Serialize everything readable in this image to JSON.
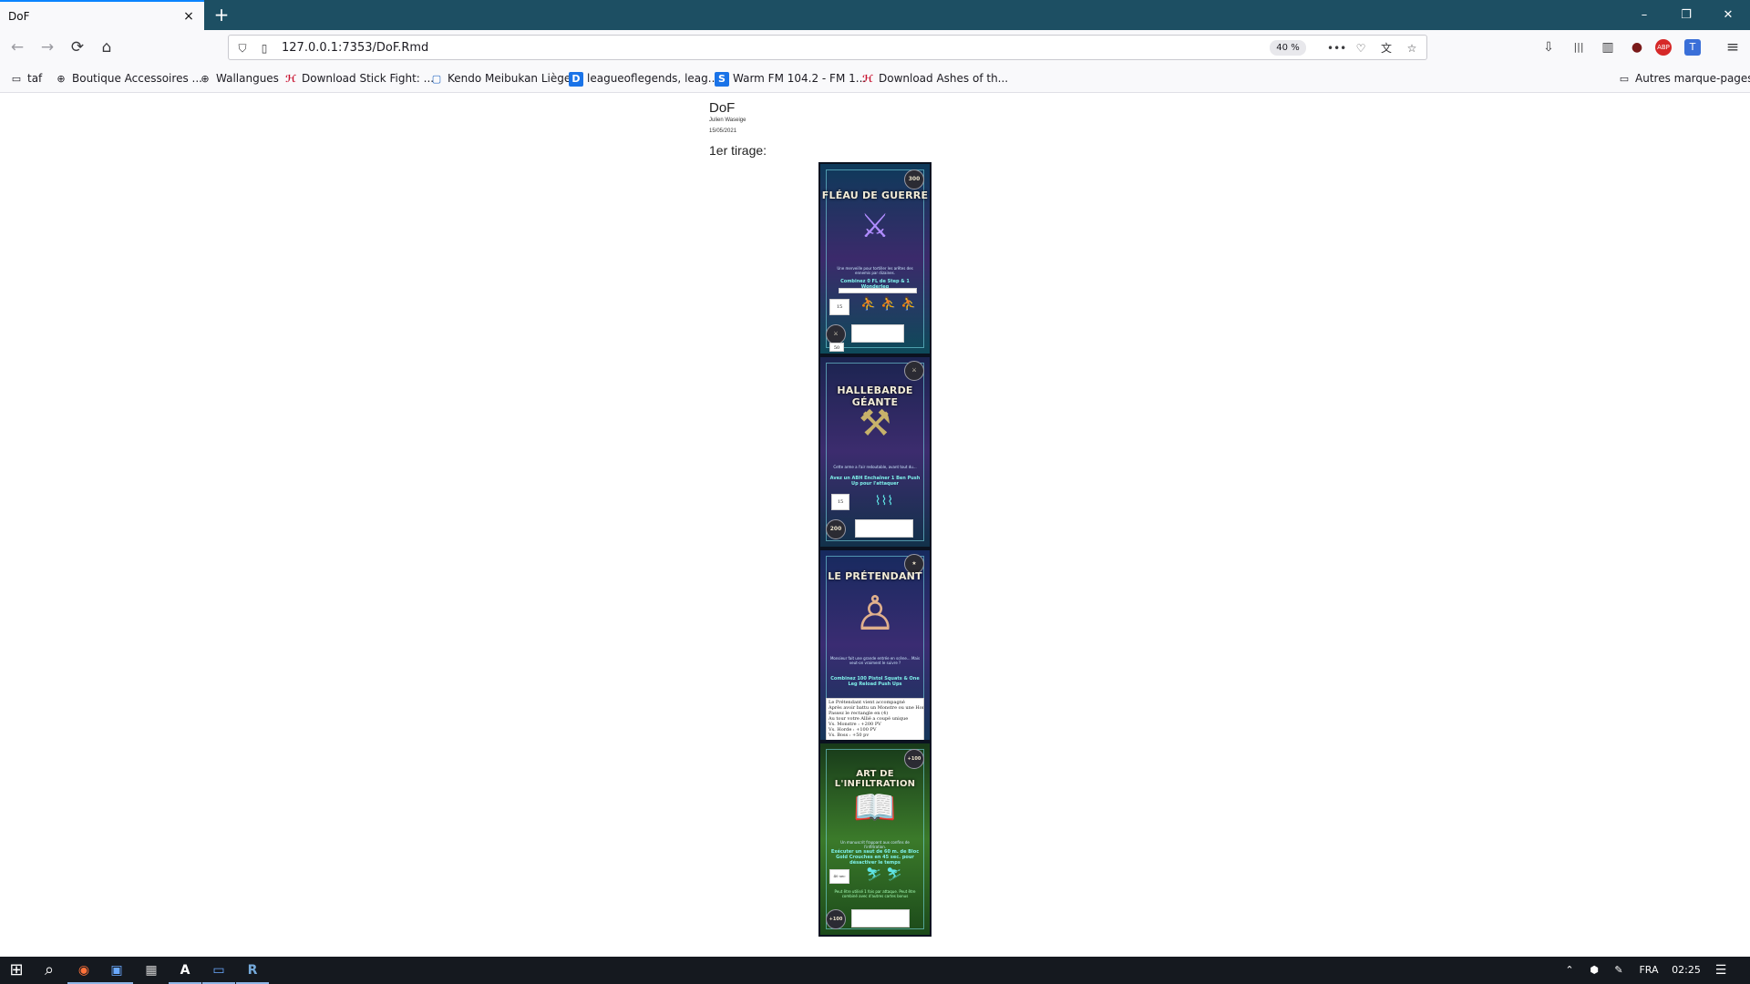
{
  "browser": {
    "tab": {
      "title": "DoF",
      "close_icon": "×"
    },
    "new_tab": "+",
    "window_controls": {
      "minimize": "–",
      "restore": "❐",
      "close": "✕"
    },
    "nav": {
      "back": "←",
      "forward": "→",
      "reload": "⟳",
      "home": "⌂"
    },
    "url": "127.0.0.1:7353/DoF.Rmd",
    "zoom": "40 %",
    "page_actions": {
      "more": "•••",
      "pocket": "♡",
      "translate": "文",
      "bookmark_star": "☆"
    },
    "toolbar_icons": {
      "downloads": "⇩",
      "library": "|||",
      "sidebar": "▥",
      "account": "●",
      "adblock": "ABP",
      "translator": "T",
      "menu": "≡"
    },
    "bookmarks": [
      {
        "label": "taf",
        "icon": "folder-icon",
        "glyph": "▭",
        "color": "#555555"
      },
      {
        "label": "Boutique Accessoires ...",
        "icon": "globe-icon",
        "glyph": "⊕",
        "color": "#555555"
      },
      {
        "label": "Wallangues",
        "icon": "globe-icon",
        "glyph": "⊕",
        "color": "#555555"
      },
      {
        "label": "Download Stick Fight: ...",
        "icon": "download-site-icon",
        "glyph": "ℋ",
        "color": "#c8102e"
      },
      {
        "label": "Kendo Meibukan Liège",
        "icon": "page-icon",
        "glyph": "▢",
        "color": "#2b6cc4"
      },
      {
        "label": "leagueoflegends, leag...",
        "icon": "site-icon",
        "glyph": "D",
        "color": "#1a73e8"
      },
      {
        "label": "Warm FM 104.2 - FM 1...",
        "icon": "radio-icon",
        "glyph": "S",
        "color": "#1a73e8"
      },
      {
        "label": "Download Ashes of th...",
        "icon": "download-site-icon",
        "glyph": "ℋ",
        "color": "#c8102e"
      }
    ],
    "other_bookmarks": "Autres marque-pages"
  },
  "document": {
    "title": "DoF",
    "author": "Julien Waseige",
    "date": "15/05/2021",
    "section": "1er tirage:"
  },
  "cards": [
    {
      "title": "FLÉAU DE GUERRE",
      "text": "Une merveille pour tortiller les arêtes des ennemis par dizaines.",
      "objective": "Combinez 0 FL de Step & 1 Wonderleg",
      "badge": "300",
      "value_box": "15",
      "stat_box": "50",
      "bg_top": "#0e3a5a",
      "bg_mid": "#3b2a6b",
      "bg_bottom": "#0e4a5a"
    },
    {
      "title": "HALLEBARDE GÉANTE",
      "text": "Cette arme a l'air redoutable, avant tout du...",
      "objective": "Avez un ABH Enchaîner 1 Ben Push Up pour l'attaquer",
      "badge": "200",
      "value_box": "15",
      "bg_top": "#1b2450",
      "bg_mid": "#3c2c6e",
      "bg_bottom": "#12314a"
    },
    {
      "title": "LE PRÉTENDANT",
      "text": "Monsieur fait une grande entrée en scène... Mais veut-on vraiment le suivre ?",
      "objective": "Combinez 100 Pistol Squats & One Leg Reload Push Ups",
      "notes": [
        "Le Prétendant vient accompagné",
        "Après avoir battu un Monstre ou une Horde",
        "Passez le rectangle en (4)",
        "Au tour votre Allié a coupé unique",
        "Vs. Monstre : +200 PV",
        "Vs. Horde : +100 PV",
        "Vs. Boss : +50 pv"
      ],
      "bg_top": "#162a5e",
      "bg_mid": "#3a2c72",
      "bg_bottom": "#15365a"
    },
    {
      "title": "ART DE L'INFILTRATION",
      "text": "Un manuscrit frappant aux confins de l'infiltration.",
      "objective": "Exécuter un saut de 60 m. de Bloc Gold Crouches en 45 sec. pour désactiver le temps",
      "extra": "Peut être utilisé 1 fois par attaque. Peut être combiné avec d'autres cartes bonus",
      "badge": "+100",
      "value_box": "40 sec",
      "bg_top": "#183a1a",
      "bg_mid": "#3b7a2a",
      "bg_bottom": "#1c4a1a"
    }
  ],
  "taskbar": {
    "start": "⊞",
    "search": "⌕",
    "apps": [
      {
        "name": "firefox-icon",
        "glyph": "◉",
        "color": "#ff7139"
      },
      {
        "name": "save-app-icon",
        "glyph": "▣",
        "color": "#6aa9ff"
      },
      {
        "name": "calculator-icon",
        "glyph": "▦",
        "color": "#cfcfcf"
      },
      {
        "name": "acrobat-icon",
        "glyph": "A",
        "color": "#e02020"
      },
      {
        "name": "window-app-icon",
        "glyph": "▭",
        "color": "#6aa9ff"
      },
      {
        "name": "r-studio-icon",
        "glyph": "R",
        "color": "#75aadb"
      }
    ],
    "tray": {
      "chevron": "⌃",
      "dropbox": "⬢",
      "pen": "✎",
      "language": "FRA",
      "time": "02:25",
      "notifications": "☰"
    }
  }
}
